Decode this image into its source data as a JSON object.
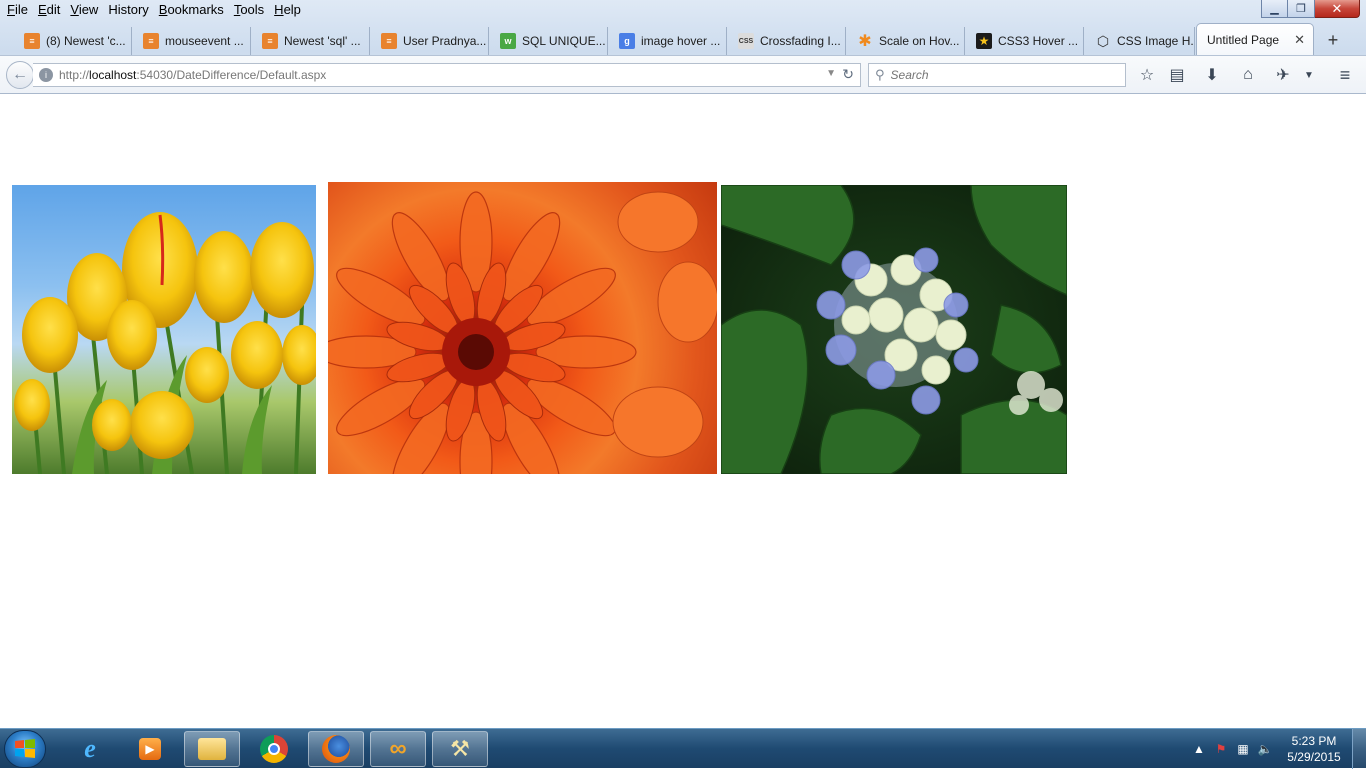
{
  "menubar": {
    "items": [
      {
        "acc": "F",
        "rest": "ile"
      },
      {
        "acc": "E",
        "rest": "dit"
      },
      {
        "acc": "V",
        "rest": "iew"
      },
      {
        "acc": "",
        "rest": "History"
      },
      {
        "acc": "B",
        "rest": "ookmarks"
      },
      {
        "acc": "T",
        "rest": "ools"
      },
      {
        "acc": "H",
        "rest": "elp"
      }
    ]
  },
  "tabs": [
    {
      "label": "(8) Newest 'c...",
      "icon": "stack-overflow-icon",
      "color": "#e8832e"
    },
    {
      "label": "mouseevent ...",
      "icon": "stack-overflow-icon",
      "color": "#e8832e"
    },
    {
      "label": "Newest 'sql' ...",
      "icon": "stack-overflow-icon",
      "color": "#e8832e"
    },
    {
      "label": "User Pradnya...",
      "icon": "stack-overflow-icon",
      "color": "#e8832e"
    },
    {
      "label": "SQL UNIQUE...",
      "icon": "w3schools-icon",
      "color": "#4aa845"
    },
    {
      "label": "image hover ...",
      "icon": "google-icon",
      "color": "#4a7ee6"
    },
    {
      "label": "Crossfading I...",
      "icon": "css3-icon",
      "color": "#555555"
    },
    {
      "label": "Scale on Hov...",
      "icon": "asterisk-icon",
      "color": "#f08a1e"
    },
    {
      "label": "CSS3 Hover ...",
      "icon": "star-icon",
      "color": "#1b1b1b"
    },
    {
      "label": "CSS Image H...",
      "icon": "codepen-icon",
      "color": "#333333"
    },
    {
      "label": "Untitled Page",
      "icon": "",
      "color": ""
    }
  ],
  "navbar": {
    "url_prefix": "http://",
    "url_host": "localhost",
    "url_rest": ":54030/DateDifference/Default.aspx",
    "search_placeholder": "Search"
  },
  "clock": {
    "time": "5:23 PM",
    "date": "5/29/2015"
  }
}
